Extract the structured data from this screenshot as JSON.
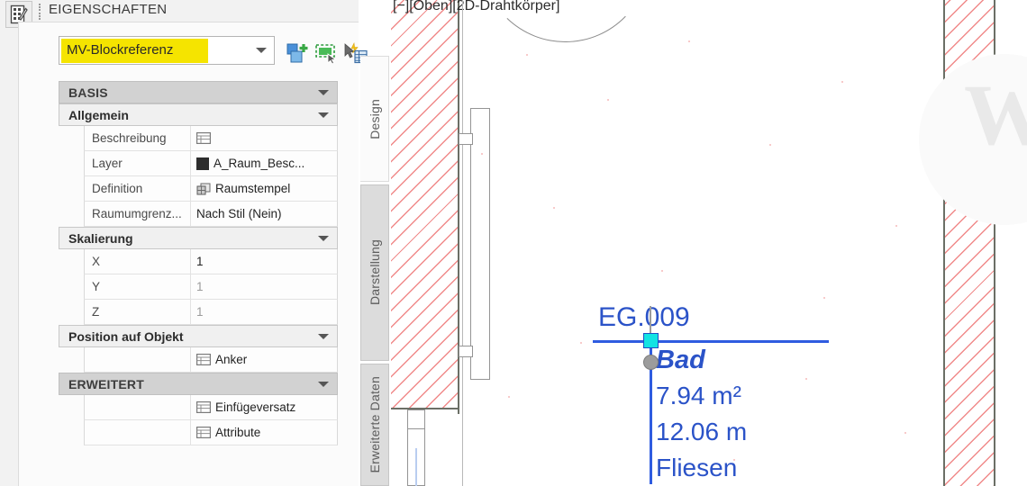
{
  "palette": {
    "title": "EIGENSCHAFTEN",
    "icon": "properties-grid-icon",
    "grip": "drag-grip-icon"
  },
  "type_selector": {
    "value": "MV-Blockreferenz",
    "highlight_color": "#f5e400",
    "arrow": "chevron-down-icon"
  },
  "toolbar_icons": [
    {
      "name": "add-block-icon",
      "title": "Neu hinzufügen"
    },
    {
      "name": "select-similar-icon",
      "title": "Ähnliche auswählen"
    },
    {
      "name": "quick-properties-icon",
      "title": "Schnelleigenschaften"
    }
  ],
  "property_grid": {
    "groups": [
      {
        "label": "BASIS",
        "kind": "category",
        "rows": []
      },
      {
        "label": "Allgemein",
        "kind": "subcategory",
        "rows": [
          {
            "name": "Beschreibung",
            "value": "",
            "icon": "table-edit-icon",
            "dim": false
          },
          {
            "name": "Layer",
            "value": "A_Raum_Besc...",
            "icon": "color-swatch-icon",
            "dim": false
          },
          {
            "name": "Definition",
            "value": "Raumstempel",
            "icon": "block-definition-icon",
            "dim": false
          },
          {
            "name": "Raumumgrenz...",
            "value": "Nach Stil (Nein)",
            "icon": "",
            "dim": false
          }
        ]
      },
      {
        "label": "Skalierung",
        "kind": "subcategory",
        "rows": [
          {
            "name": "X",
            "value": "1",
            "icon": "",
            "dim": false
          },
          {
            "name": "Y",
            "value": "1",
            "icon": "",
            "dim": true
          },
          {
            "name": "Z",
            "value": "1",
            "icon": "",
            "dim": true
          }
        ]
      },
      {
        "label": "Position auf Objekt",
        "kind": "subcategory",
        "rows": [
          {
            "name": "",
            "value": "Anker",
            "icon": "table-edit-icon",
            "dim": false
          }
        ]
      },
      {
        "label": "ERWEITERT",
        "kind": "category",
        "rows": [
          {
            "name": "",
            "value": "Einfügeversatz",
            "icon": "table-edit-icon",
            "dim": false
          },
          {
            "name": "",
            "value": "Attribute",
            "icon": "table-edit-icon",
            "dim": false
          }
        ]
      }
    ]
  },
  "vertical_tabs": [
    {
      "label": "Design",
      "active": true
    },
    {
      "label": "Darstellung",
      "active": false
    },
    {
      "label": "Erweiterte Daten",
      "active": false
    }
  ],
  "canvas": {
    "viewport_label": "[−][Oben][2D-Drahtkörper]",
    "watermark": "W",
    "wall_hatch_color": "#f08a8a",
    "wall_edge_color": "#6b6f66"
  },
  "room_stamp": {
    "id": "EG.009",
    "name": "Bad",
    "area": "7.94 m²",
    "perimeter": "12.06 m",
    "finish": "Fliesen",
    "text_color": "#2b53c8",
    "grip_square_color": "#12e3e3",
    "grip_circle_color": "#9c9c9c"
  }
}
